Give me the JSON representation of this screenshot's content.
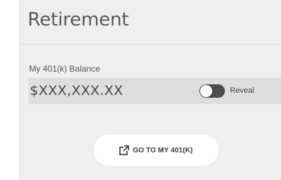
{
  "card": {
    "title": "Retirement"
  },
  "balance": {
    "label": "My 401(k) Balance",
    "value": "$XXX,XXX.XX",
    "reveal_label": "Reveal",
    "reveal_on": false
  },
  "actions": {
    "goto_label": "GO TO MY 401(K)",
    "goto_icon": "external-link-icon"
  },
  "colors": {
    "card_background": "#efefef",
    "balance_row": "#dedede",
    "toggle_track": "#4d4d4d",
    "text": "#595959"
  }
}
